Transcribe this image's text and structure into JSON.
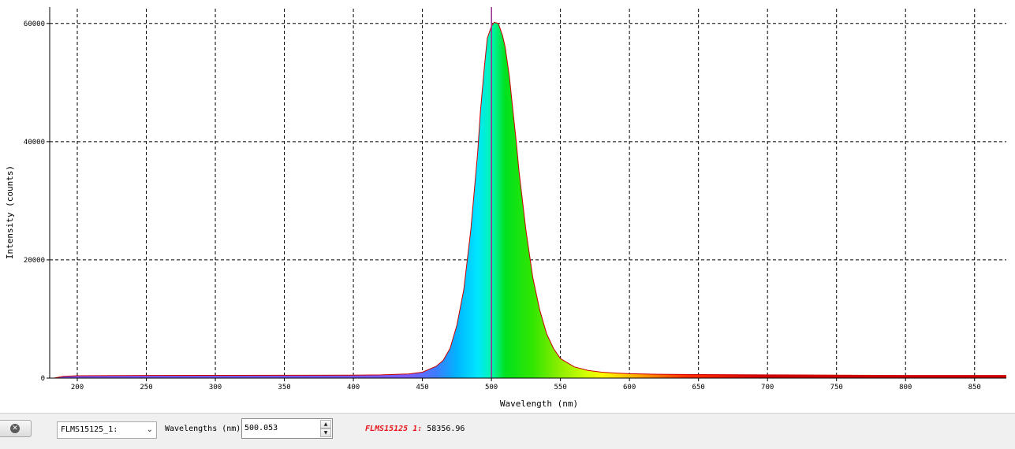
{
  "chart_data": {
    "type": "area",
    "xlabel": "Wavelength (nm)",
    "ylabel": "Intensity (counts)",
    "xlim": [
      180,
      873
    ],
    "ylim": [
      0,
      62500
    ],
    "x_ticks": [
      200,
      250,
      300,
      350,
      400,
      450,
      500,
      550,
      600,
      650,
      700,
      750,
      800,
      850
    ],
    "y_ticks": [
      0,
      20000,
      40000,
      60000
    ],
    "grid": true,
    "grid_style": "dashed",
    "cursor_wavelength": 500.053,
    "series": [
      {
        "color": "#cc0000",
        "fill": "wavelength-spectrum-colors",
        "x": [
          183,
          190,
          200,
          250,
          300,
          350,
          400,
          420,
          440,
          450,
          460,
          465,
          470,
          475,
          480,
          485,
          490,
          492,
          495,
          497,
          500,
          502,
          505,
          508,
          510,
          513,
          515,
          518,
          520,
          525,
          530,
          535,
          540,
          545,
          550,
          560,
          570,
          580,
          590,
          600,
          620,
          650,
          700,
          750,
          800,
          850,
          873
        ],
        "y": [
          0,
          300,
          400,
          450,
          470,
          480,
          500,
          550,
          700,
          1000,
          2000,
          3000,
          5000,
          9000,
          15000,
          25000,
          38000,
          45000,
          53000,
          57500,
          59500,
          60200,
          60000,
          58000,
          56000,
          51000,
          46500,
          40000,
          35000,
          25000,
          17000,
          11500,
          7500,
          5000,
          3300,
          1900,
          1300,
          1000,
          850,
          750,
          650,
          600,
          550,
          500,
          450,
          450,
          450
        ]
      }
    ]
  },
  "controls": {
    "device_select": "FLMS15125_1:",
    "wavelength_label": "Wavelengths (nm)",
    "wavelength_value": "500.053",
    "readout_name": "FLMS15125 1:",
    "readout_value": " 58356.96"
  },
  "icons": {
    "close": "close-icon",
    "dropdown": "chevron-down-icon",
    "spin_up": "spin-up-icon",
    "spin_down": "spin-down-icon"
  },
  "colors": {
    "series_line": "#cc0000",
    "cursor": "#9b2d8e",
    "readout_name": "#e8141c"
  }
}
